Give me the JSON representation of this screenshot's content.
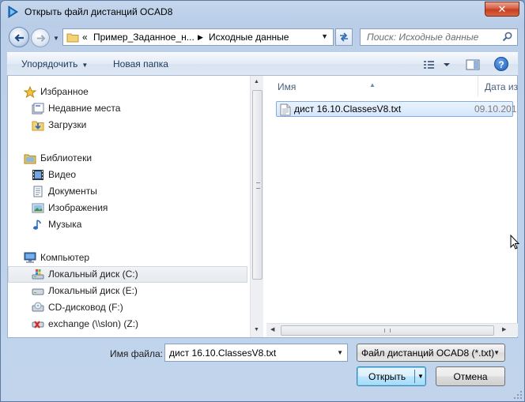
{
  "window": {
    "title": "Открыть файл дистанций OCAD8",
    "close_glyph": "✕"
  },
  "address": {
    "overflow": "«",
    "crumbs": [
      "Пример_Заданное_н...",
      "Исходные данные"
    ],
    "search_placeholder": "Поиск: Исходные данные"
  },
  "toolbar": {
    "organize_label": "Упорядочить",
    "new_folder_label": "Новая папка",
    "help_label": "?"
  },
  "nav": {
    "items": [
      {
        "label": "Избранное",
        "icon": "star-icon"
      },
      {
        "label": "Недавние места",
        "icon": "recent-places-icon"
      },
      {
        "label": "Загрузки",
        "icon": "downloads-folder-icon"
      },
      {
        "label": "Библиотеки",
        "icon": "libraries-icon"
      },
      {
        "label": "Видео",
        "icon": "video-library-icon"
      },
      {
        "label": "Документы",
        "icon": "documents-library-icon"
      },
      {
        "label": "Изображения",
        "icon": "pictures-library-icon"
      },
      {
        "label": "Музыка",
        "icon": "music-library-icon"
      },
      {
        "label": "Компьютер",
        "icon": "computer-icon"
      },
      {
        "label": "Локальный диск (C:)",
        "icon": "system-drive-icon"
      },
      {
        "label": "Локальный диск (E:)",
        "icon": "hard-drive-icon"
      },
      {
        "label": "CD-дисковод (F:)",
        "icon": "cd-drive-icon"
      },
      {
        "label": "exchange (\\\\slon) (Z:)",
        "icon": "network-drive-disconnected-icon"
      }
    ]
  },
  "files": {
    "columns": {
      "name": "Имя",
      "date": "Дата изм"
    },
    "rows": [
      {
        "name": "дист 16.10.ClassesV8.txt",
        "date": "09.10.201"
      }
    ]
  },
  "bottom": {
    "filename_label": "Имя файла:",
    "filename_value": "дист 16.10.ClassesV8.txt",
    "filetype_value": "Файл дистанций OCAD8 (*.txt)",
    "open_label": "Открыть",
    "cancel_label": "Отмена"
  },
  "colors": {
    "frame": "#bcd0ea",
    "selection": "#d5e6fb",
    "close_button": "#c33b1e"
  }
}
